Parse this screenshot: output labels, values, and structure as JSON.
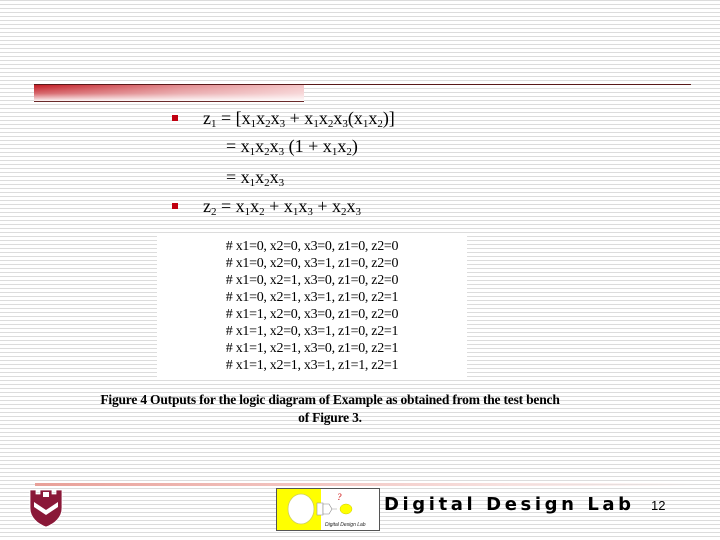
{
  "slide": {
    "bullets": [
      {
        "type": "bullet",
        "parts": [
          [
            "z",
            "1"
          ],
          [
            " = [x",
            "1"
          ],
          [
            "x",
            "2"
          ],
          [
            "x",
            "3"
          ],
          [
            " + x",
            "1"
          ],
          [
            "x",
            "2"
          ],
          [
            "x",
            "3"
          ],
          [
            "(x",
            "1"
          ],
          [
            "x",
            "2"
          ],
          [
            ")]",
            ""
          ]
        ]
      },
      {
        "type": "continuation",
        "parts": [
          [
            "= x",
            "1"
          ],
          [
            "x",
            "2"
          ],
          [
            "x",
            "3"
          ],
          [
            " (1 + x",
            "1"
          ],
          [
            "x",
            "2"
          ],
          [
            ")",
            ""
          ]
        ]
      },
      {
        "type": "continuation",
        "parts": [
          [
            "= x",
            "1"
          ],
          [
            "x",
            "2"
          ],
          [
            "x",
            "3"
          ]
        ]
      },
      {
        "type": "bullet",
        "parts": [
          [
            "z",
            "2"
          ],
          [
            " = x",
            "1"
          ],
          [
            "x",
            "2"
          ],
          [
            " + x",
            "1"
          ],
          [
            "x",
            "3"
          ],
          [
            " + x",
            "2"
          ],
          [
            "x",
            "3"
          ]
        ]
      }
    ],
    "simulation_output": [
      "# x1=0, x2=0, x3=0, z1=0, z2=0",
      "# x1=0, x2=0, x3=1, z1=0, z2=0",
      "# x1=0, x2=1, x3=0, z1=0, z2=0",
      "# x1=0, x2=1, x3=1, z1=0, z2=1",
      "# x1=1, x2=0, x3=0, z1=0, z2=0",
      "# x1=1, x2=0, x3=1, z1=0, z2=1",
      "# x1=1, x2=1, x3=0, z1=0, z2=1",
      "# x1=1, x2=1, x3=1, z1=1, z2=1"
    ],
    "caption_line1": "Figure 4  Outputs for the logic diagram of Example as obtained from the test bench",
    "caption_line2": "of Figure 3.",
    "footer": {
      "lab_name": "Digital Design Lab",
      "lab_logo_text": "Digital Design Lab",
      "lab_logo_mark": "?",
      "page_number": "12"
    },
    "colors": {
      "accent_red": "#c0141c",
      "bullet_red": "#c00010",
      "shield_maroon": "#8a1838",
      "logo_yellow": "#ffff00"
    }
  }
}
